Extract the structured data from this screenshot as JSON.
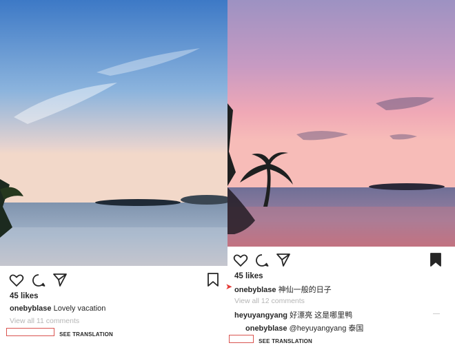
{
  "colors": {
    "date_outline": "#d9534f",
    "muted_text": "#b5b5b5",
    "arrow_red": "#e53935"
  },
  "left_post": {
    "photo": "tropical sea at dusk with palm trees",
    "likes": "45 likes",
    "caption": {
      "user": "onebyblase",
      "text": "Lovely vacation"
    },
    "view_comments": "View all 11 comments",
    "date": "",
    "see_translation": "SEE TRANSLATION",
    "icons": [
      "heart-icon",
      "comment-icon",
      "share-icon",
      "bookmark-outline-icon"
    ]
  },
  "right_post": {
    "photo": "pink sunset sky over sea with palm trees",
    "likes": "45 likes",
    "caption": {
      "user": "onebyblase",
      "text": "神仙一般的日子"
    },
    "view_comments": "View all 12 comments",
    "comments": [
      {
        "user": "heyuyangyang",
        "text": "好漂亮 这是哪里鸭"
      },
      {
        "user": "onebyblase",
        "text": "@heyuyangyang 泰国"
      }
    ],
    "date": "",
    "see_translation": "SEE TRANSLATION",
    "icons": [
      "heart-icon",
      "comment-icon",
      "share-icon",
      "bookmark-filled-icon"
    ]
  }
}
